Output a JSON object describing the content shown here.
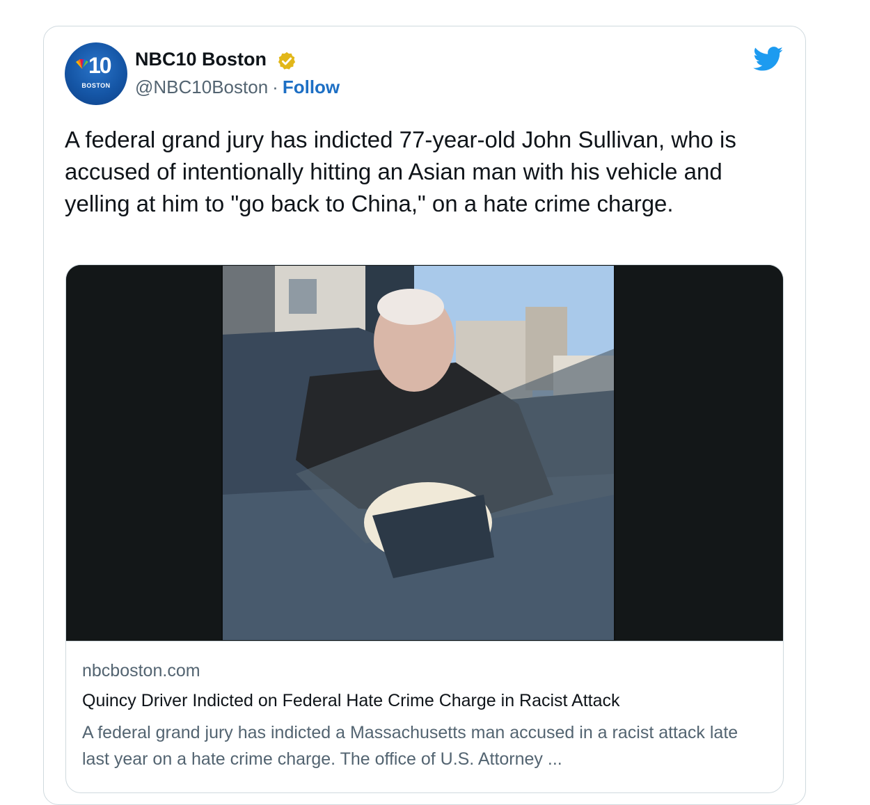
{
  "tweet": {
    "author": {
      "display_name": "NBC10 Boston",
      "handle": "@NBC10Boston",
      "separator": "·",
      "follow_label": "Follow",
      "verified_icon": "verified-badge-icon",
      "avatar": {
        "number": "10",
        "city": "BOSTON"
      }
    },
    "platform_icon": "twitter-bird-icon",
    "text": "A federal grand jury has indicted 77-year-old John Sullivan, who is accused of intentionally hitting an Asian man with his vehicle and yelling at him to \"go back to China,\" on a hate crime charge.",
    "link_card": {
      "domain": "nbcboston.com",
      "title": "Quincy Driver Indicted on Federal Hate Crime Charge in Racist Attack",
      "description": "A federal grand jury has indicted a Massachusetts man accused in a racist attack late last year on a hate crime charge. The office of U.S. Attorney ..."
    }
  },
  "colors": {
    "follow_blue": "#1d6fc4",
    "twitter_blue": "#1d9bf0",
    "verified_gold": "#e2b719",
    "muted_text": "#536471",
    "border": "#cfd9de"
  }
}
